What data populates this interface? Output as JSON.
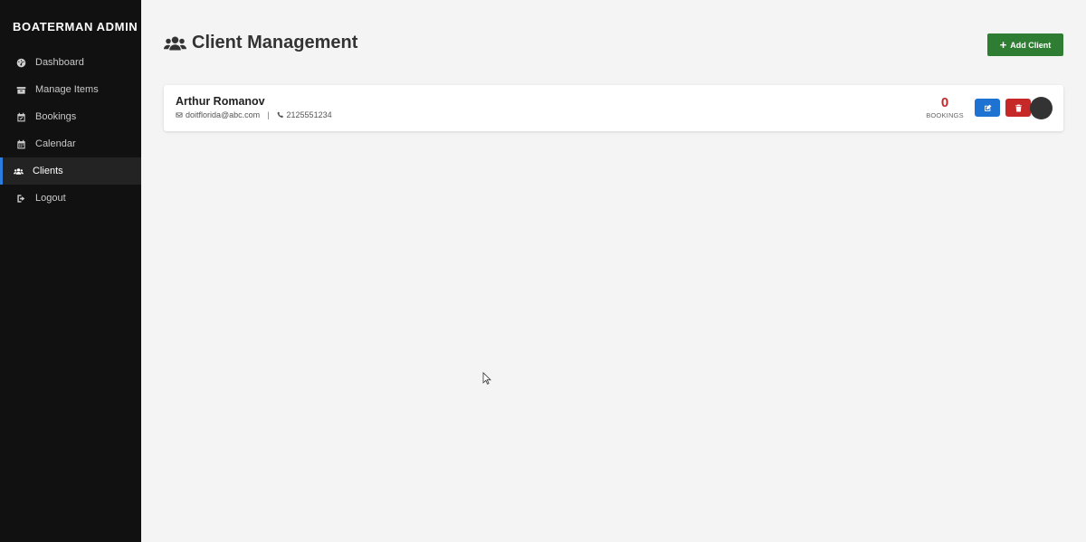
{
  "sidebar": {
    "brand": "BOATERMAN ADMIN",
    "items": [
      {
        "label": "Dashboard",
        "icon": "dashboard-icon",
        "active": false
      },
      {
        "label": "Manage Items",
        "icon": "box-icon",
        "active": false
      },
      {
        "label": "Bookings",
        "icon": "calendar-check-icon",
        "active": false
      },
      {
        "label": "Calendar",
        "icon": "calendar-icon",
        "active": false
      },
      {
        "label": "Clients",
        "icon": "users-icon",
        "active": true
      },
      {
        "label": "Logout",
        "icon": "logout-icon",
        "active": false
      }
    ]
  },
  "header": {
    "title": "Client Management",
    "title_icon": "users-icon",
    "add_button_label": "Add Client"
  },
  "clients": [
    {
      "name": "Arthur Romanov",
      "email": "doitflorida@abc.com",
      "phone": "2125551234",
      "bookings_count": "0",
      "bookings_label": "BOOKINGS"
    }
  ],
  "colors": {
    "sidebar_bg": "#111111",
    "accent_active": "#2b7de0",
    "add_button": "#2e7d32",
    "edit_button": "#1e73d2",
    "delete_button": "#c62828",
    "bookings_count": "#c62828"
  }
}
